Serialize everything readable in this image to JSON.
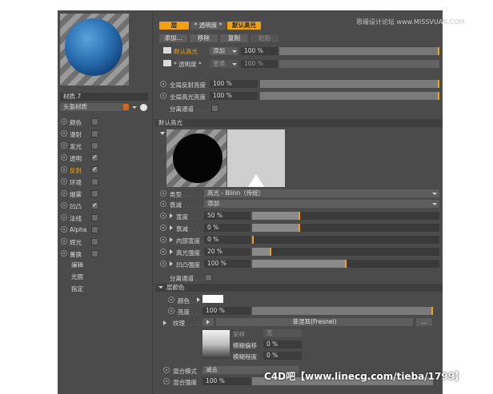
{
  "watermark_top": "思缘设计论坛 www.MISSVUAN.COM",
  "watermark_bottom": "C4D吧【www.linecg.com/tieba/1799】",
  "left": {
    "material_name": "材质.7",
    "layer_name": "头盔材质",
    "channels": [
      {
        "label": "颜色",
        "checked": false,
        "active": false
      },
      {
        "label": "漫射",
        "checked": false,
        "active": false
      },
      {
        "label": "发光",
        "checked": false,
        "active": false
      },
      {
        "label": "透明",
        "checked": true,
        "active": false
      },
      {
        "label": "反射",
        "checked": true,
        "active": true
      },
      {
        "label": "环境",
        "checked": false,
        "active": false
      },
      {
        "label": "烟雾",
        "checked": false,
        "active": false
      },
      {
        "label": "凹凸",
        "checked": true,
        "active": false
      },
      {
        "label": "法线",
        "checked": false,
        "active": false
      },
      {
        "label": "Alpha",
        "checked": false,
        "active": false
      },
      {
        "label": "辉光",
        "checked": false,
        "active": false
      },
      {
        "label": "置换",
        "checked": false,
        "active": false
      }
    ],
    "extra": [
      "编辑",
      "光照",
      "指定"
    ]
  },
  "tabs": {
    "layer": "层",
    "transparency": "* 透明度 *",
    "default_highlight": "默认高光"
  },
  "actions": {
    "add": "添加...",
    "remove": "移除",
    "copy": "复制",
    "paste": "粘贴"
  },
  "layer_rows": [
    {
      "name": "默认高光",
      "mode": "添加",
      "value": "100 %"
    },
    {
      "name": "* 透明度 *",
      "mode": "普通",
      "value": "100 %"
    }
  ],
  "global": [
    {
      "label": "全局反射亮度",
      "value": "100 %"
    },
    {
      "label": "全局高光亮度",
      "value": "100 %"
    }
  ],
  "separate_pass": "分离通道",
  "section_title": "默认高光",
  "type": {
    "label": "类型",
    "value": "高光 - Blinn（传统）"
  },
  "attenuation": {
    "label": "衰减",
    "value": "添加"
  },
  "params": [
    {
      "label": "宽度",
      "value": "50 %",
      "level": 0.5
    },
    {
      "label": "衰减",
      "value": "0 %",
      "level": 0.5
    },
    {
      "label": "内部宽度",
      "value": "0 %",
      "level": 0.0
    },
    {
      "label": "高光强度",
      "value": "20 %",
      "level": 0.2
    },
    {
      "label": "凹凸强度",
      "value": "100 %",
      "level": 1.0
    }
  ],
  "separate_pass2": "分离通道",
  "layer_color": {
    "title": "层颜色",
    "color_label": "颜色",
    "brightness_label": "亮度",
    "brightness_value": "100 %",
    "texture_label": "纹理",
    "texture_value": "菲涅耳(Fresnel)",
    "more_button": "...",
    "sampling_label": "采样",
    "sampling_value": "无",
    "blur_offset_label": "模糊偏移",
    "blur_offset_value": "0 %",
    "blur_scale_label": "模糊程度",
    "blur_scale_value": "0 %",
    "blend_mode_label": "混合模式",
    "blend_mode_value": "减去",
    "blend_strength_label": "混合强度",
    "blend_strength_value": "100 %"
  },
  "colors": {
    "accent": "#f1a10f",
    "panel": "#4b4b4b",
    "swatch": "#ffffff",
    "layer_swatch": "#c8692e"
  }
}
